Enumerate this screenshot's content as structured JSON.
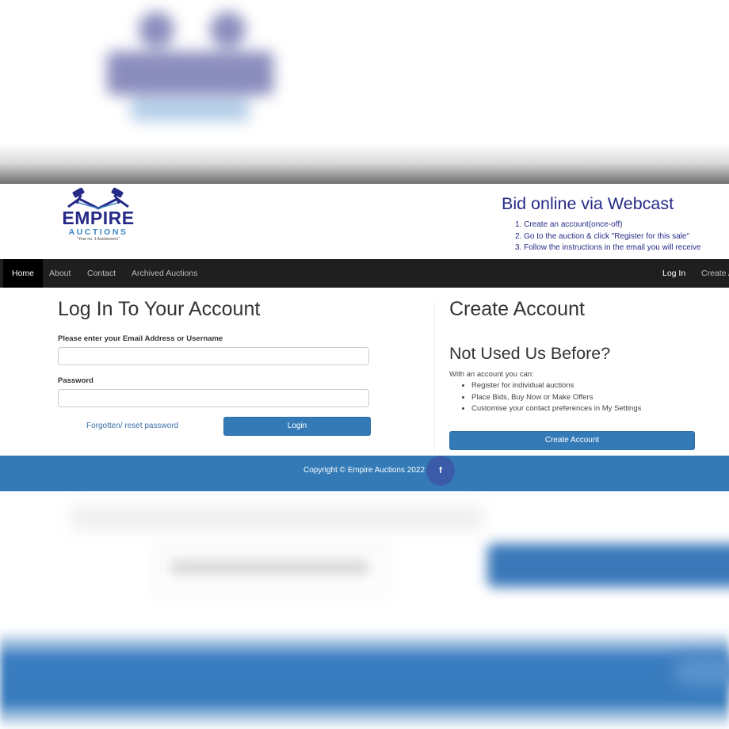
{
  "logo": {
    "word": "EMPIRE",
    "sub": "AUCTIONS",
    "tagline": "\"Your no. 1 Auctioneers\""
  },
  "webcast": {
    "title": "Bid online via Webcast",
    "steps": [
      "1. Create an account(once-off)",
      "2. Go to the auction & click \"Register for this sale\"",
      "3. Follow the instructions in the email you will receive"
    ]
  },
  "nav": {
    "left": [
      "Home",
      "About",
      "Contact",
      "Archived Auctions"
    ],
    "login": "Log In",
    "create": "Create A"
  },
  "login": {
    "title": "Log In To Your Account",
    "email_label": "Please enter your Email Address or Username",
    "email_value": "",
    "password_label": "Password",
    "password_value": "",
    "forgot": "Forgotten/ reset password",
    "button": "Login"
  },
  "create": {
    "title": "Create Account",
    "subtitle": "Not Used Us Before?",
    "intro": "With an account you can:",
    "benefits": [
      "Register for individual auctions",
      "Place Bids, Buy Now or Make Offers",
      "Customise your contact preferences in My Settings"
    ],
    "button": "Create Account"
  },
  "footer": {
    "copyright": "Copyright © Empire Auctions 2022",
    "facebook_icon": "f"
  },
  "colors": {
    "primary": "#337ab7",
    "brand_navy": "#262b87",
    "navbar": "#1f1f1f",
    "facebook": "#3b5ba8"
  }
}
